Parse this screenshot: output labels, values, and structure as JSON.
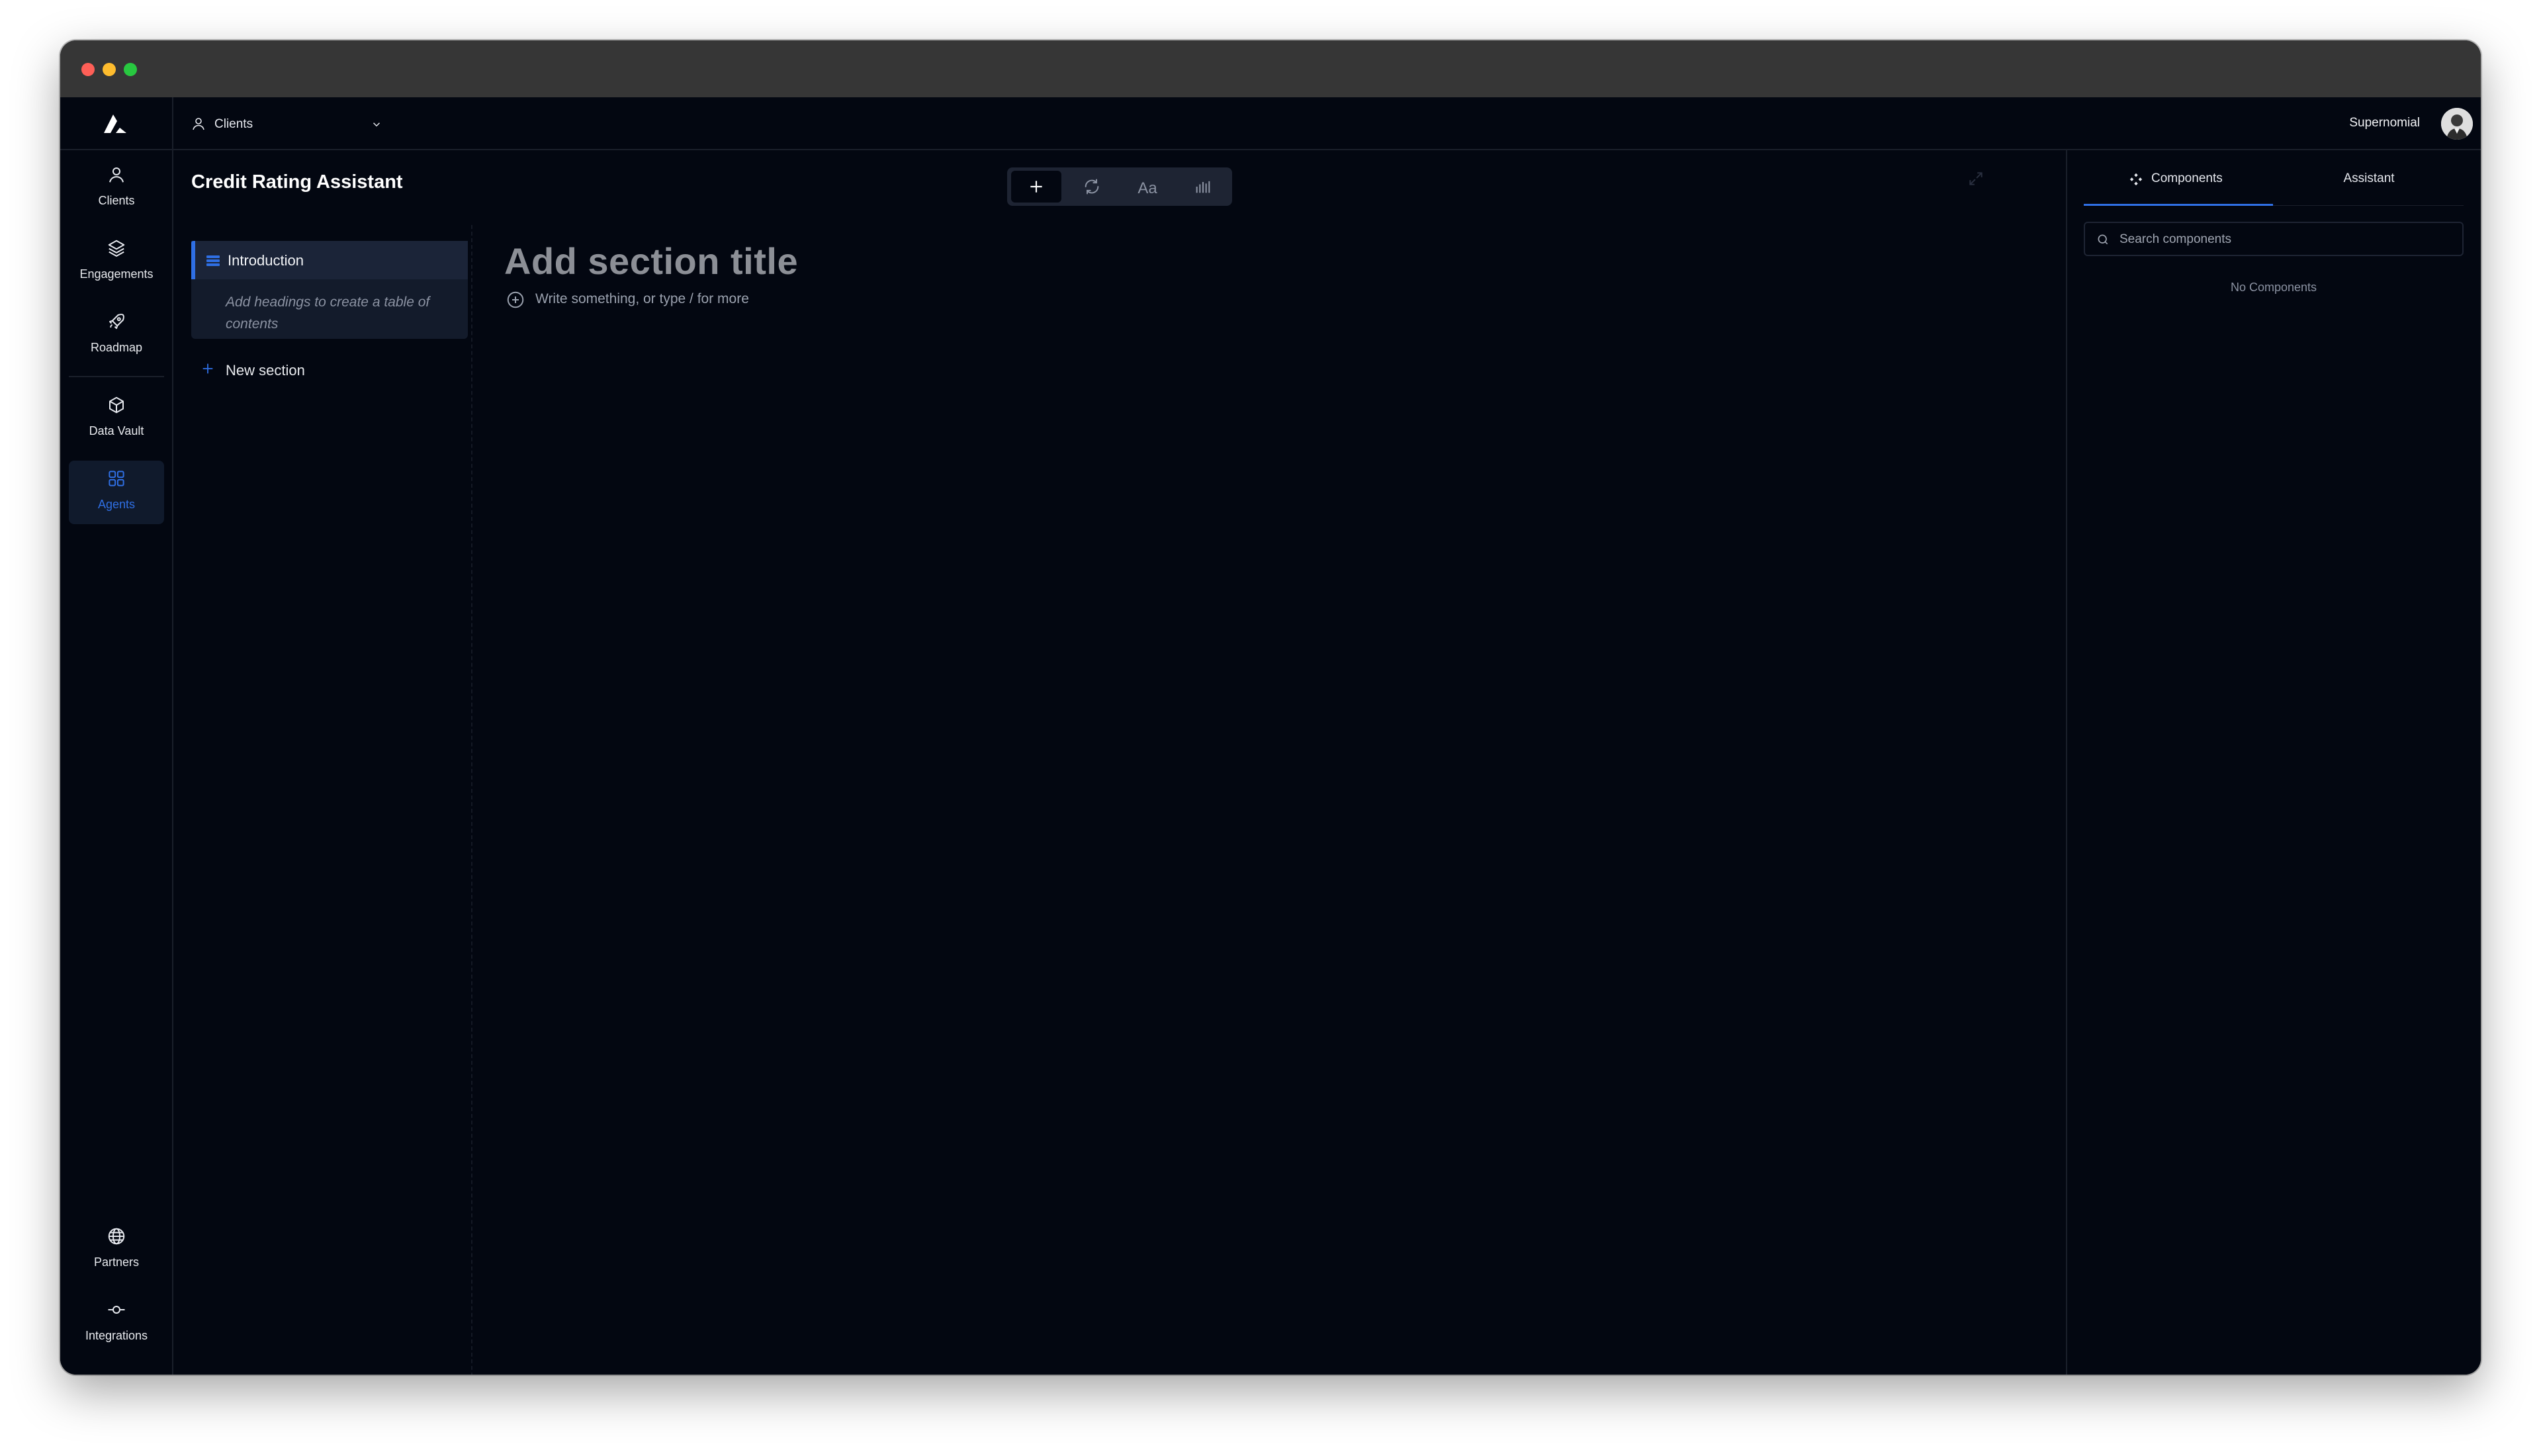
{
  "window": {
    "traffic_lights": {
      "close": "#fe5f57",
      "minimize": "#febc2e",
      "zoom": "#28c840"
    }
  },
  "theme": {
    "background": "#030711",
    "accent": "#2f6fe4",
    "surface": "#131b2b"
  },
  "nav": {
    "logo_icon": "brand-logo",
    "items": [
      {
        "label": "Clients",
        "icon": "user-icon"
      },
      {
        "label": "Engagements",
        "icon": "layers-icon"
      },
      {
        "label": "Roadmap",
        "icon": "rocket-icon"
      },
      {
        "label": "Data Vault",
        "icon": "box-icon"
      },
      {
        "label": "Agents",
        "icon": "grid-icon",
        "active": true
      }
    ],
    "bottom_items": [
      {
        "label": "Partners",
        "icon": "globe-icon"
      },
      {
        "label": "Integrations",
        "icon": "commit-icon"
      }
    ]
  },
  "topbar": {
    "client_switcher": {
      "label": "Clients"
    },
    "user": {
      "name": "Supernomial"
    }
  },
  "document": {
    "title": "Credit Rating Assistant",
    "toolbar": {
      "text_tool_label": "Aa",
      "active_tool": "add"
    },
    "toc": {
      "items": [
        {
          "label": "Introduction",
          "hint": "Add headings to create a table of contents"
        }
      ],
      "new_section_label": "New section"
    },
    "section": {
      "title_placeholder": "Add section title",
      "body_placeholder": "Write something, or type / for more"
    }
  },
  "right_panel": {
    "tabs": [
      {
        "label": "Components",
        "active": true
      },
      {
        "label": "Assistant"
      }
    ],
    "search": {
      "placeholder": "Search components",
      "value": ""
    },
    "empty_text": "No Components"
  }
}
